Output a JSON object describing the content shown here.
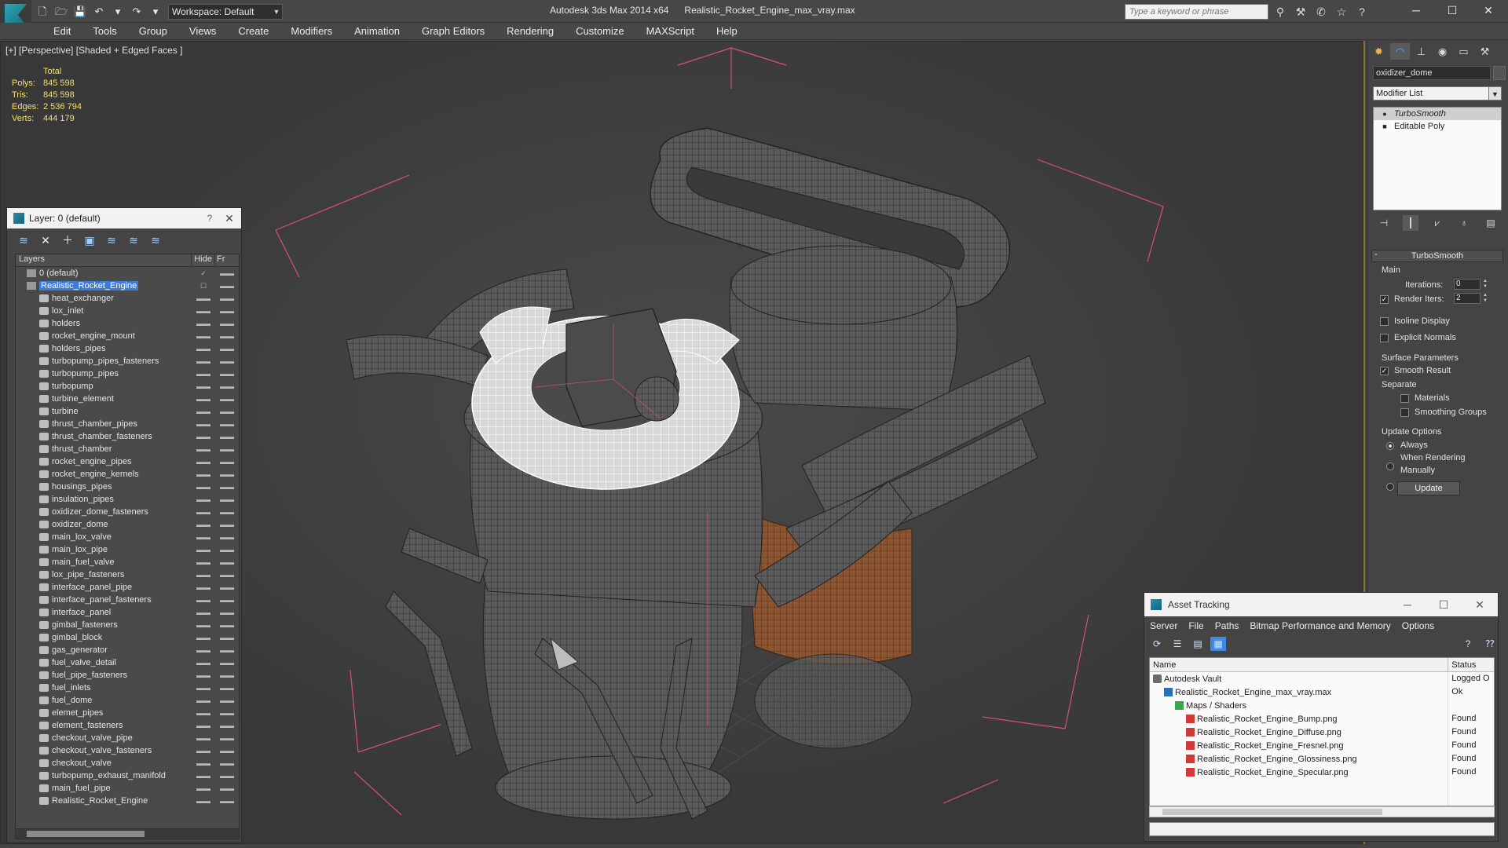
{
  "window": {
    "title": "Autodesk 3ds Max 2014 x64      Realistic_Rocket_Engine_max_vray.max",
    "workspace": "Workspace: Default",
    "search_placeholder": "Type a keyword or phrase",
    "controls": [
      "─",
      "☐",
      "✕"
    ]
  },
  "quick_access": [
    "🗋",
    "🗁",
    "💾",
    "↶",
    "▾",
    "↷",
    "▾",
    "⧉"
  ],
  "menu": [
    "Edit",
    "Tools",
    "Group",
    "Views",
    "Create",
    "Modifiers",
    "Animation",
    "Graph Editors",
    "Rendering",
    "Customize",
    "MAXScript",
    "Help"
  ],
  "viewport": {
    "label": "[+] [Perspective] [Shaded + Edged Faces ]",
    "stats": {
      "total_label": "Total",
      "rows": [
        {
          "label": "Polys:",
          "value": "845 598"
        },
        {
          "label": "Tris:",
          "value": "845 598"
        },
        {
          "label": "Edges:",
          "value": "2 536 794"
        },
        {
          "label": "Verts:",
          "value": "444 179"
        }
      ]
    }
  },
  "layer_panel": {
    "title": "Layer: 0 (default)",
    "help": "?",
    "close": "✕",
    "col_layers": "Layers",
    "col_hide": "Hide",
    "col_fr": "Fr",
    "layers": [
      {
        "name": "0 (default)",
        "type": "layer",
        "check": "✓"
      },
      {
        "name": "Realistic_Rocket_Engine",
        "type": "layer",
        "selected": true,
        "check": "☐"
      }
    ],
    "objects": [
      "heat_exchanger",
      "lox_inlet",
      "holders",
      "rocket_engine_mount",
      "holders_pipes",
      "turbopump_pipes_fasteners",
      "turbopump_pipes",
      "turbopump",
      "turbine_element",
      "turbine",
      "thrust_chamber_pipes",
      "thrust_chamber_fasteners",
      "thrust_chamber",
      "rocket_engine_pipes",
      "rocket_engine_kernels",
      "housings_pipes",
      "insulation_pipes",
      "oxidizer_dome_fasteners",
      "oxidizer_dome",
      "main_lox_valve",
      "main_lox_pipe",
      "main_fuel_valve",
      "lox_pipe_fasteners",
      "interface_panel_pipe",
      "interface_panel_fasteners",
      "interface_panel",
      "gimbal_fasteners",
      "gimbal_block",
      "gas_generator",
      "fuel_valve_detail",
      "fuel_pipe_fasteners",
      "fuel_inlets",
      "fuel_dome",
      "elemet_pipes",
      "element_fasteners",
      "checkout_valve_pipe",
      "checkout_valve_fasteners",
      "checkout_valve",
      "turbopump_exhaust_manifold",
      "main_fuel_pipe",
      "Realistic_Rocket_Engine"
    ],
    "hide_glyph": "▬▬"
  },
  "command_panel": {
    "object_name": "oxidizer_dome",
    "modifier_list": "Modifier List",
    "stack": [
      {
        "name": "TurboSmooth",
        "active": true
      },
      {
        "name": "Editable Poly",
        "active": false
      }
    ],
    "rollout_title": "TurboSmooth",
    "main_label": "Main",
    "iterations_label": "Iterations:",
    "iterations_value": "0",
    "render_iters_label": "Render Iters:",
    "render_iters_value": "2",
    "isoline_label": "Isoline Display",
    "explicit_label": "Explicit Normals",
    "surface_label": "Surface Parameters",
    "smooth_label": "Smooth Result",
    "separate_label": "Separate",
    "materials_label": "Materials",
    "smoothing_groups_label": "Smoothing Groups",
    "update_options_label": "Update Options",
    "always_label": "Always",
    "when_rendering_label": "When Rendering",
    "manually_label": "Manually",
    "update_button": "Update"
  },
  "asset_tracking": {
    "title": "Asset Tracking",
    "menu": [
      "Server",
      "File",
      "Paths",
      "Bitmap Performance and Memory",
      "Options"
    ],
    "col_name": "Name",
    "col_status": "Status",
    "rows": [
      {
        "name": "Autodesk Vault",
        "status": "Logged O",
        "indent": 0,
        "icon": "vault"
      },
      {
        "name": "Realistic_Rocket_Engine_max_vray.max",
        "status": "Ok",
        "indent": 1,
        "icon": "max"
      },
      {
        "name": "Maps / Shaders",
        "status": "",
        "indent": 2,
        "icon": "maps"
      },
      {
        "name": "Realistic_Rocket_Engine_Bump.png",
        "status": "Found",
        "indent": 3,
        "icon": "png"
      },
      {
        "name": "Realistic_Rocket_Engine_Diffuse.png",
        "status": "Found",
        "indent": 3,
        "icon": "png"
      },
      {
        "name": "Realistic_Rocket_Engine_Fresnel.png",
        "status": "Found",
        "indent": 3,
        "icon": "png"
      },
      {
        "name": "Realistic_Rocket_Engine_Glossiness.png",
        "status": "Found",
        "indent": 3,
        "icon": "png"
      },
      {
        "name": "Realistic_Rocket_Engine_Specular.png",
        "status": "Found",
        "indent": 3,
        "icon": "png"
      }
    ]
  },
  "colors": {
    "accent": "#3c7bd6",
    "stats_text": "#f4e06a",
    "bounding_box": "#d94f7a",
    "viewport_border": "#8a7a2e"
  }
}
